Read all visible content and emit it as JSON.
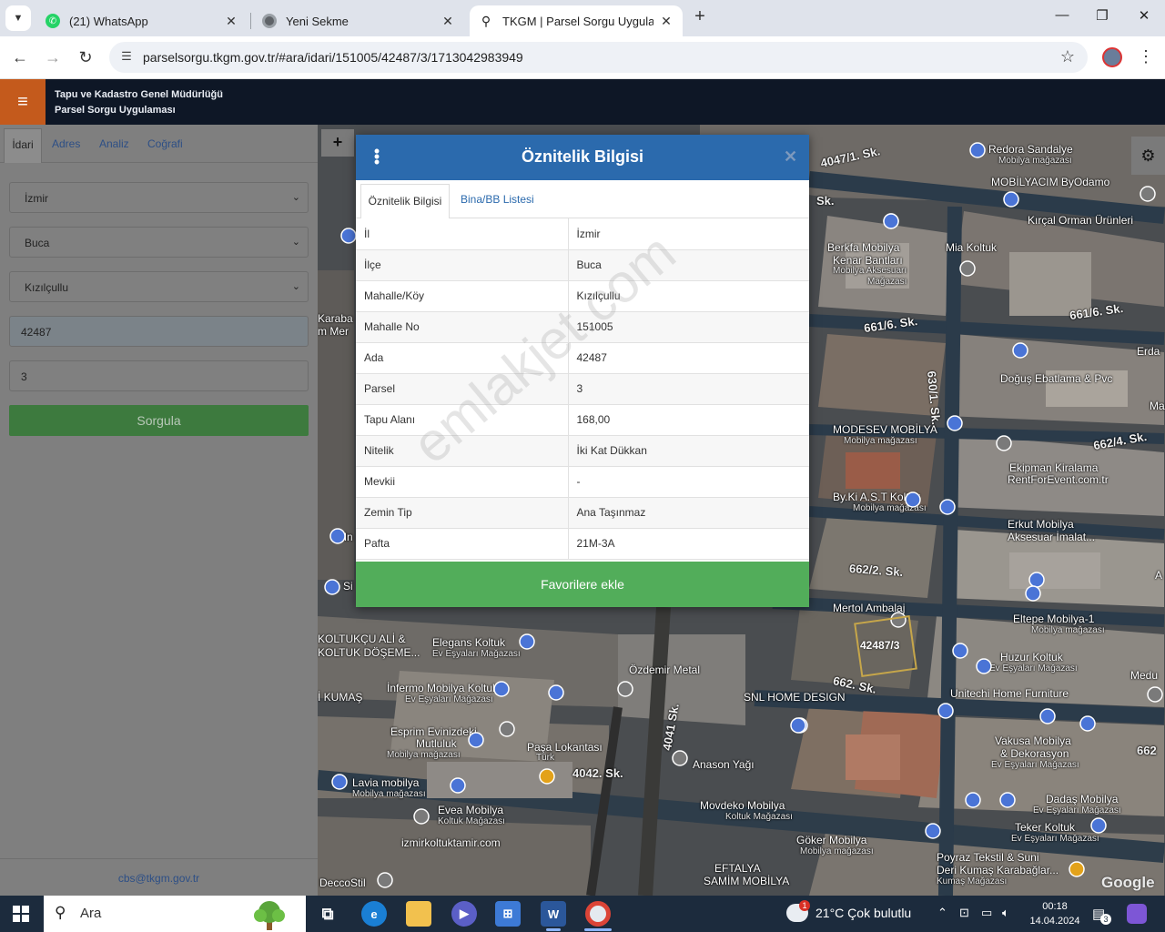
{
  "browser": {
    "tabs": [
      {
        "title": "(21) WhatsApp",
        "icon": "whatsapp-icon"
      },
      {
        "title": "Yeni Sekme",
        "icon": "chrome-icon"
      },
      {
        "title": "TKGM | Parsel Sorgu Uygulaması",
        "icon": "location-pin-icon"
      }
    ],
    "url": "parselsorgu.tkgm.gov.tr/#ara/idari/151005/42487/3/1713042983949"
  },
  "app": {
    "title_line1": "Tapu ve Kadastro Genel Müdürlüğü",
    "title_line2": "Parsel Sorgu Uygulaması"
  },
  "left_panel": {
    "tabs": [
      "İdari",
      "Adres",
      "Analiz",
      "Coğrafi"
    ],
    "il_select": "İzmir",
    "ilce_select": "Buca",
    "mahalle_select": "Kızılçullu",
    "ada_input": "42487",
    "parsel_input": "3",
    "search_button": "Sorgula",
    "footer_email": "cbs@tkgm.gov.tr"
  },
  "modal": {
    "title": "Öznitelik Bilgisi",
    "tabs": [
      "Öznitelik Bilgisi",
      "Bina/BB Listesi"
    ],
    "rows": [
      {
        "key": "İl",
        "value": "İzmir"
      },
      {
        "key": "İlçe",
        "value": "Buca"
      },
      {
        "key": "Mahalle/Köy",
        "value": "Kızılçullu"
      },
      {
        "key": "Mahalle No",
        "value": "151005"
      },
      {
        "key": "Ada",
        "value": "42487"
      },
      {
        "key": "Parsel",
        "value": "3"
      },
      {
        "key": "Tapu Alanı",
        "value": "168,00"
      },
      {
        "key": "Nitelik",
        "value": "İki Kat Dükkan"
      },
      {
        "key": "Mevkii",
        "value": "-"
      },
      {
        "key": "Zemin Tip",
        "value": "Ana Taşınmaz"
      },
      {
        "key": "Pafta",
        "value": "21M-3A"
      }
    ],
    "favorite_button": "Favorilere ekle",
    "watermark": "emlakjet.com"
  },
  "map": {
    "parcel_label": "42487/3",
    "attribution": "Google",
    "labels": [
      {
        "text": "4047/1. Sk.",
        "kind": "street"
      },
      {
        "text": "Redora Sandalye",
        "kind": "poi"
      },
      {
        "text": "Mobilya mağazası",
        "kind": "sub"
      },
      {
        "text": "MOBİLYACIM ByOdamo",
        "kind": "poi"
      },
      {
        "text": "Kırçal Orman Ürünleri",
        "kind": "poi"
      },
      {
        "text": "Berkfa Mobilya",
        "kind": "poi"
      },
      {
        "text": "Kenar Bantları",
        "kind": "poi"
      },
      {
        "text": "Mobilya Aksesuarı",
        "kind": "sub"
      },
      {
        "text": "Mağazası",
        "kind": "sub"
      },
      {
        "text": "Mia Koltuk",
        "kind": "poi"
      },
      {
        "text": "661/6. Sk.",
        "kind": "street"
      },
      {
        "text": "661/6. Sk.",
        "kind": "street"
      },
      {
        "text": "630/1. Sk.",
        "kind": "street"
      },
      {
        "text": "Doğuş Ebatlama & Pvc",
        "kind": "poi"
      },
      {
        "text": "MODESEV MOBİLYA",
        "kind": "poi"
      },
      {
        "text": "Mobilya mağazası",
        "kind": "sub"
      },
      {
        "text": "662/4. Sk.",
        "kind": "street"
      },
      {
        "text": "Ekipman Kiralama",
        "kind": "poi"
      },
      {
        "text": "RentForEvent.com.tr",
        "kind": "poi"
      },
      {
        "text": "By.Ki A.S.T Koltuk",
        "kind": "poi"
      },
      {
        "text": "Mobilya mağazası",
        "kind": "sub"
      },
      {
        "text": "Erkut Mobilya",
        "kind": "poi"
      },
      {
        "text": "Aksesuar İmalat...",
        "kind": "poi"
      },
      {
        "text": "662/2. Sk.",
        "kind": "street"
      },
      {
        "text": "Mertol Ambalaj",
        "kind": "poi"
      },
      {
        "text": "Eltepe Mobilya-1",
        "kind": "poi"
      },
      {
        "text": "Mobilya mağazası",
        "kind": "sub"
      },
      {
        "text": "Huzur Koltuk",
        "kind": "poi"
      },
      {
        "text": "Ev Eşyaları Mağazası",
        "kind": "sub"
      },
      {
        "text": "662. Sk.",
        "kind": "street"
      },
      {
        "text": "Unitechi Home Furniture",
        "kind": "poi"
      },
      {
        "text": "KOLTUKÇU ALİ &",
        "kind": "poi"
      },
      {
        "text": "KOLTUK DÖŞEME...",
        "kind": "poi"
      },
      {
        "text": "Elegans Koltuk",
        "kind": "poi"
      },
      {
        "text": "Ev Eşyaları Mağazası",
        "kind": "sub"
      },
      {
        "text": "Özdemir Metal",
        "kind": "poi"
      },
      {
        "text": "SNL HOME DESIGN",
        "kind": "poi"
      },
      {
        "text": "İnfermo Mobilya Koltuk",
        "kind": "poi"
      },
      {
        "text": "Ev Eşyaları Mağazası",
        "kind": "sub"
      },
      {
        "text": "4041 Sk.",
        "kind": "street"
      },
      {
        "text": "Esprim Evinizdeki",
        "kind": "poi"
      },
      {
        "text": "Mutluluk",
        "kind": "poi"
      },
      {
        "text": "Mobilya mağazası",
        "kind": "sub"
      },
      {
        "text": "Paşa Lokantası",
        "kind": "poi"
      },
      {
        "text": "Türk",
        "kind": "sub"
      },
      {
        "text": "Anason Yağı",
        "kind": "poi"
      },
      {
        "text": "Vakusa Mobilya",
        "kind": "poi"
      },
      {
        "text": "& Dekorasyon",
        "kind": "poi"
      },
      {
        "text": "Ev Eşyaları Mağazası",
        "kind": "sub"
      },
      {
        "text": "4042. Sk.",
        "kind": "street"
      },
      {
        "text": "Lavia mobilya",
        "kind": "poi"
      },
      {
        "text": "Mobilya mağazası",
        "kind": "sub"
      },
      {
        "text": "Evea Mobilya",
        "kind": "poi"
      },
      {
        "text": "Koltuk Mağazası",
        "kind": "sub"
      },
      {
        "text": "Movdeko Mobilya",
        "kind": "poi"
      },
      {
        "text": "Koltuk Mağazası",
        "kind": "sub"
      },
      {
        "text": "Dadaş Mobilya",
        "kind": "poi"
      },
      {
        "text": "Ev Eşyaları Mağazası",
        "kind": "sub"
      },
      {
        "text": "Teker Koltuk",
        "kind": "poi"
      },
      {
        "text": "Ev Eşyaları Mağazası",
        "kind": "sub"
      },
      {
        "text": "izmirkoltuktamir.com",
        "kind": "poi"
      },
      {
        "text": "Göker Mobilya",
        "kind": "poi"
      },
      {
        "text": "Mobilya mağazası",
        "kind": "sub"
      },
      {
        "text": "Poyraz Tekstil & Suni",
        "kind": "poi"
      },
      {
        "text": "Deri Kumaş Karabağlar...",
        "kind": "poi"
      },
      {
        "text": "Kumaş Mağazası",
        "kind": "sub"
      },
      {
        "text": "EFTALYA",
        "kind": "poi"
      },
      {
        "text": "SAMİM MOBİLYA",
        "kind": "poi"
      },
      {
        "text": "DeccoStil",
        "kind": "poi"
      },
      {
        "text": "Karaba",
        "kind": "poi"
      },
      {
        "text": "m Mer",
        "kind": "poi"
      },
      {
        "text": "Mn",
        "kind": "poi"
      },
      {
        "text": "Si",
        "kind": "poi"
      },
      {
        "text": "İ KUMAŞ",
        "kind": "poi"
      },
      {
        "text": "Erda",
        "kind": "poi"
      },
      {
        "text": "Ma",
        "kind": "poi"
      },
      {
        "text": "Medu",
        "kind": "poi"
      },
      {
        "text": "662",
        "kind": "street"
      },
      {
        "text": "A",
        "kind": "poi"
      },
      {
        "text": "Sk.",
        "kind": "street"
      }
    ]
  },
  "taskbar": {
    "search_placeholder": "Ara",
    "weather": "21°C  Çok bulutlu",
    "time": "00:18",
    "date": "14.04.2024",
    "notifications": "3",
    "weather_alert": "1"
  }
}
